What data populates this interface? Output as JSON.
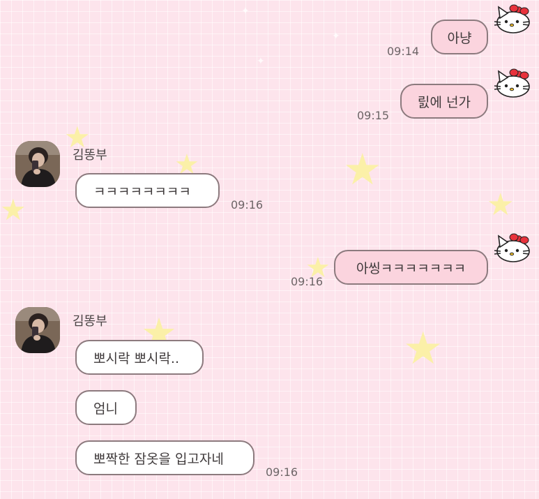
{
  "chat": {
    "sender_name": "김똥부",
    "messages": [
      {
        "side": "me",
        "text": "아냥",
        "time": "09:14"
      },
      {
        "side": "me",
        "text": "릸에 넌가",
        "time": "09:15"
      },
      {
        "side": "other",
        "text": "ㅋㅋㅋㅋㅋㅋㅋㅋ",
        "time": "09:16"
      },
      {
        "side": "me",
        "text": "아씽ㅋㅋㅋㅋㅋㅋㅋ",
        "time": "09:16"
      },
      {
        "side": "other",
        "text": "뽀시락 뽀시락..",
        "time": ""
      },
      {
        "side": "other",
        "text": "엄니",
        "time": ""
      },
      {
        "side": "other",
        "text": "뽀짝한 잠옷을 입고자네",
        "time": "09:16"
      }
    ]
  },
  "icons": {
    "my_avatar": "hello-kitty-icon",
    "other_avatar": "profile-photo",
    "decoration": "star-icon"
  },
  "colors": {
    "background": "#fde4ec",
    "my_bubble": "#fbd4de",
    "other_bubble": "#ffffff",
    "bubble_border": "#8c7a7e",
    "star": "#fbf0a8"
  }
}
